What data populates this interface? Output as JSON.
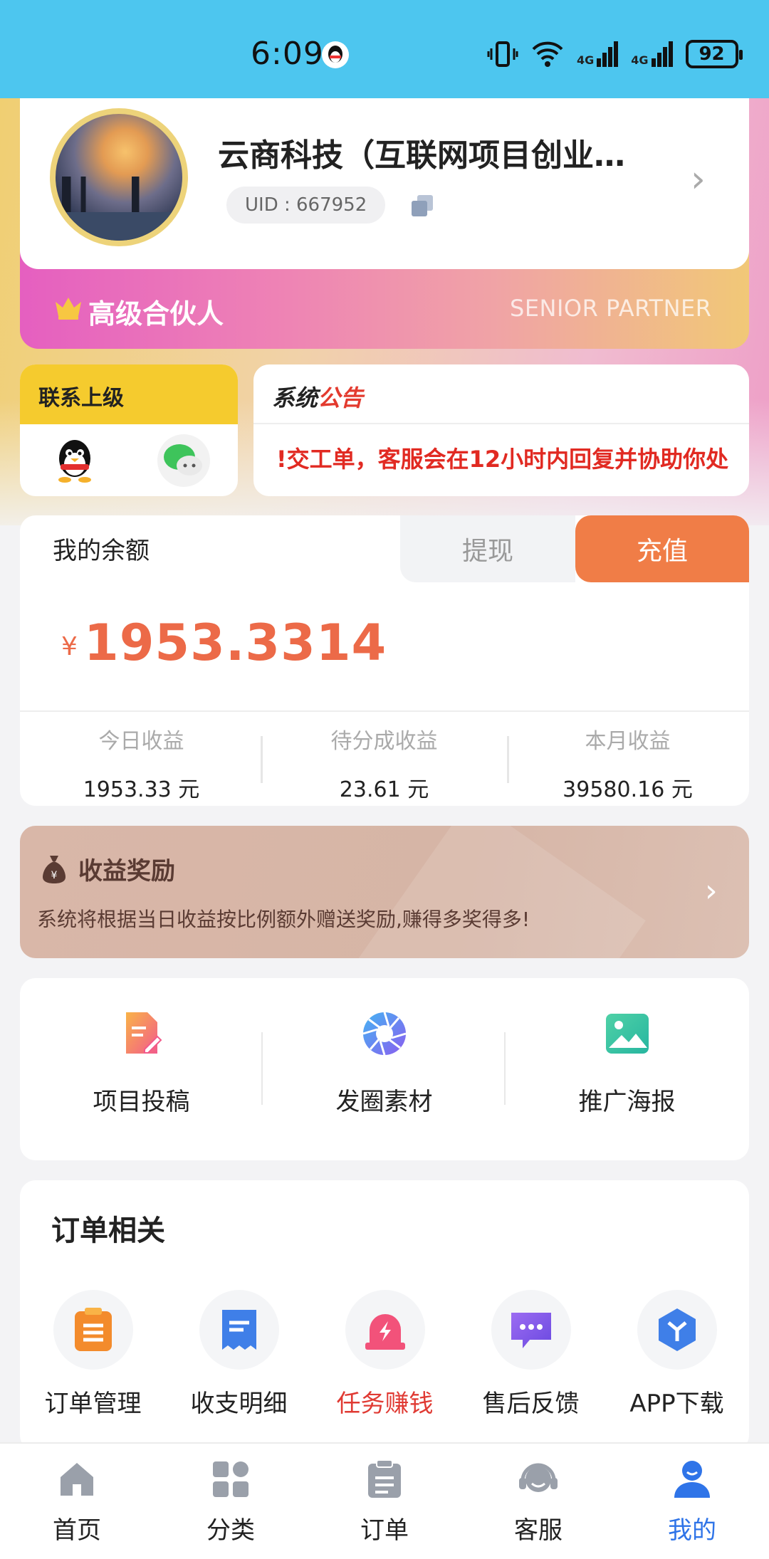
{
  "status_bar": {
    "time": "6:09",
    "battery": "92",
    "network_labels": [
      "4G",
      "4G"
    ]
  },
  "profile": {
    "name": "云商科技（互联网项目创业…",
    "uid": "UID : 667952"
  },
  "partner": {
    "title": "高级合伙人",
    "subtitle": "SENIOR PARTNER"
  },
  "contact": {
    "title": "联系上级"
  },
  "notice": {
    "title_a": "系统",
    "title_b": "公告",
    "text": "!交工单，客服会在12小时内回复并协助你处"
  },
  "balance": {
    "label": "我的余额",
    "withdraw": "提现",
    "recharge": "充值",
    "currency": "¥",
    "amount": "1953.3314",
    "stats": [
      {
        "label": "今日收益",
        "value": "1953.33 元"
      },
      {
        "label": "待分成收益",
        "value": "23.61 元"
      },
      {
        "label": "本月收益",
        "value": "39580.16 元"
      }
    ]
  },
  "reward": {
    "title": "收益奖励",
    "desc": "系统将根据当日收益按比例额外赠送奖励,赚得多奖得多!"
  },
  "tools": [
    {
      "label": "项目投稿",
      "icon": "document-edit-icon"
    },
    {
      "label": "发圈素材",
      "icon": "aperture-icon"
    },
    {
      "label": "推广海报",
      "icon": "image-icon"
    }
  ],
  "orders": {
    "title": "订单相关",
    "items": [
      {
        "label": "订单管理",
        "icon": "clipboard-icon"
      },
      {
        "label": "收支明细",
        "icon": "receipt-icon"
      },
      {
        "label": "任务赚钱",
        "icon": "alarm-bolt-icon",
        "highlight": true
      },
      {
        "label": "售后反馈",
        "icon": "chat-bubble-icon"
      },
      {
        "label": "APP下载",
        "icon": "app-cube-icon"
      }
    ]
  },
  "nav": [
    {
      "label": "首页",
      "icon": "home-icon"
    },
    {
      "label": "分类",
      "icon": "grid-icon"
    },
    {
      "label": "订单",
      "icon": "order-icon"
    },
    {
      "label": "客服",
      "icon": "headset-icon"
    },
    {
      "label": "我的",
      "icon": "person-icon",
      "active": true
    }
  ],
  "colors": {
    "accent": "#f07d47",
    "amount": "#ec6a48",
    "nav_active": "#2f74e8",
    "notice_red": "#e12a22",
    "status_bar": "#4dc6ef"
  }
}
